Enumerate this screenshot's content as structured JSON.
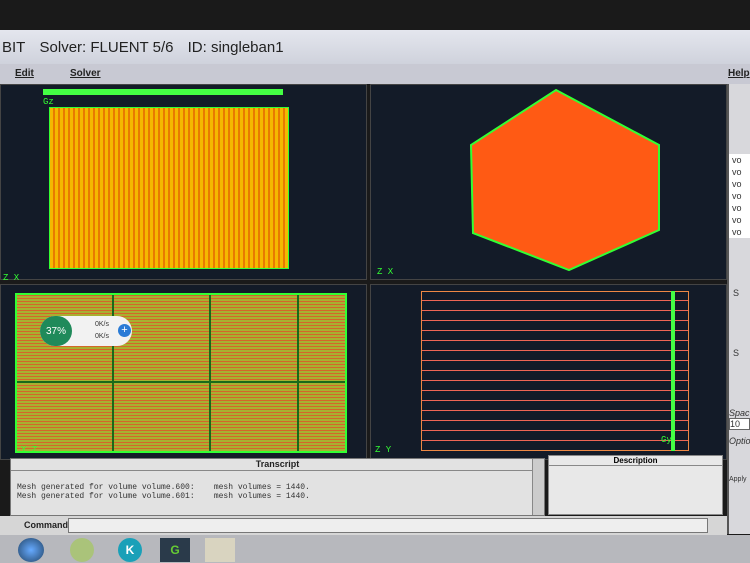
{
  "window": {
    "title_app": "BIT",
    "title_solver": "Solver: FLUENT 5/6",
    "title_id": "ID: singleban1"
  },
  "menu": {
    "edit": "Edit",
    "solver": "Solver",
    "help": "Help"
  },
  "viewports": {
    "tl_axis": "Z X",
    "tl_label": "Gz",
    "tr_axis": "Z X",
    "bl_axis": "Y Z",
    "br_axis": "Z Y",
    "br_label": "Gy"
  },
  "badge": {
    "percent": "37%",
    "up": "0K/s",
    "down": "0K/s"
  },
  "right_panel": {
    "items": [
      "vo",
      "vo",
      "vo",
      "vo",
      "vo",
      "vo",
      "vo"
    ],
    "s1": "S",
    "s2": "S",
    "spacing": "Spac",
    "spacing_value": "10",
    "options": "Option",
    "apply": "Apply"
  },
  "transcript": {
    "title": "Transcript",
    "lines": [
      "Mesh generated for volume volume.600:    mesh volumes = 1440.",
      "Mesh generated for volume volume.601:    mesh volumes = 1440."
    ]
  },
  "description": {
    "title": "Description"
  },
  "command": {
    "label": "Command:",
    "value": ""
  }
}
